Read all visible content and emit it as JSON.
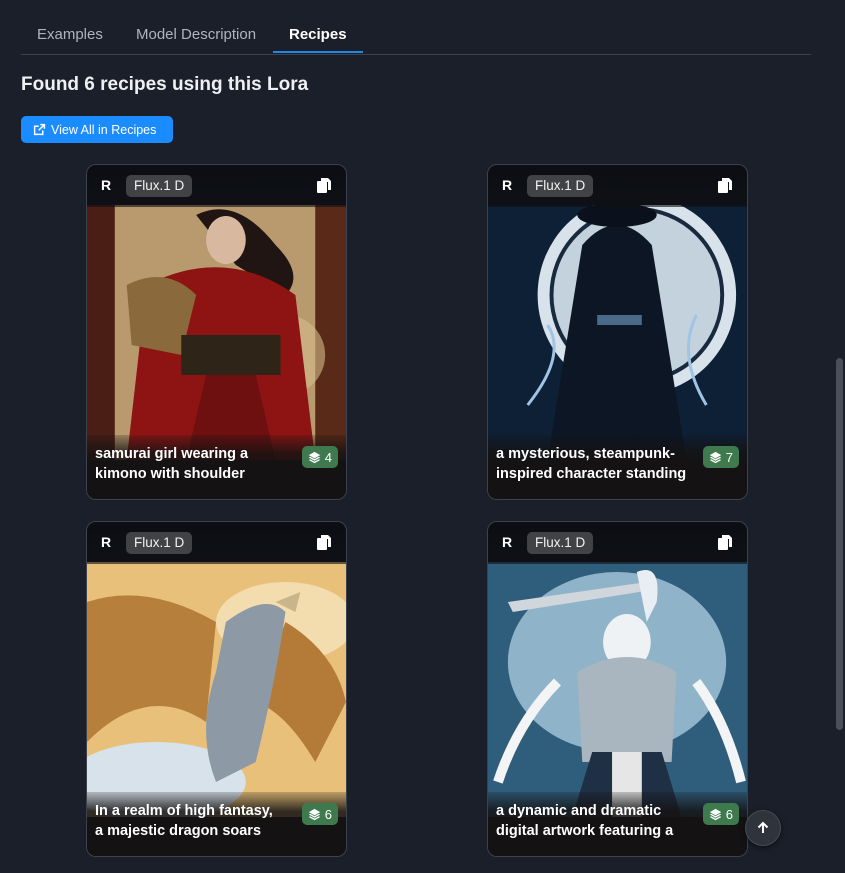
{
  "tabs": [
    {
      "label": "Examples",
      "active": false
    },
    {
      "label": "Model Description",
      "active": false
    },
    {
      "label": "Recipes",
      "active": true
    }
  ],
  "recipes_section": {
    "title": "Found 6 recipes using this Lora",
    "view_all_label": "View All in Recipes",
    "cards": [
      {
        "badge": "R",
        "model": "Flux.1 D",
        "caption_line1": "samurai girl wearing a",
        "caption_line2": "kimono with shoulder",
        "lora_count": "4",
        "icons": [
          "copy-icon",
          "layers-icon"
        ]
      },
      {
        "badge": "R",
        "model": "Flux.1 D",
        "caption_line1": "a mysterious, steampunk-",
        "caption_line2": "inspired character standing",
        "lora_count": "7",
        "icons": [
          "copy-icon",
          "layers-icon"
        ]
      },
      {
        "badge": "R",
        "model": "Flux.1 D",
        "caption_line1": "In a realm of high fantasy,",
        "caption_line2": "a majestic dragon soars",
        "lora_count": "6",
        "icons": [
          "copy-icon",
          "layers-icon"
        ]
      },
      {
        "badge": "R",
        "model": "Flux.1 D",
        "caption_line1": "a dynamic and dramatic",
        "caption_line2": "digital artwork featuring a",
        "lora_count": "6",
        "icons": [
          "copy-icon",
          "layers-icon"
        ]
      }
    ]
  },
  "colors": {
    "background": "#1b1f2a",
    "accent": "#1a8cff",
    "count_badge": "#3f7a4f"
  },
  "icons": {
    "view_all": "external-link-icon",
    "back_to_top": "arrow-up-icon"
  }
}
